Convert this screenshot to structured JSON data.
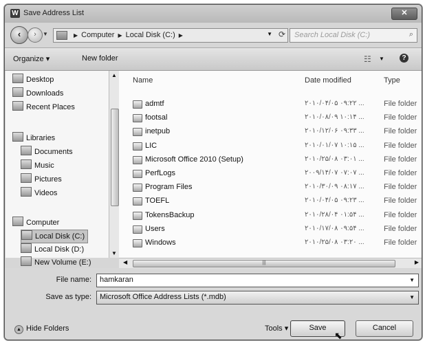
{
  "window": {
    "title": "Save Address List",
    "app_icon_letter": "W",
    "close_label": "✕"
  },
  "address": {
    "crumbs": [
      "Computer",
      "Local Disk (C:)"
    ]
  },
  "search": {
    "placeholder": "Search Local Disk (C:)"
  },
  "toolbar": {
    "organize": "Organize ▾",
    "new_folder": "New folder"
  },
  "nav": {
    "favorites": [
      {
        "label": "Desktop"
      },
      {
        "label": "Downloads"
      },
      {
        "label": "Recent Places"
      }
    ],
    "libraries_label": "Libraries",
    "libraries": [
      {
        "label": "Documents"
      },
      {
        "label": "Music"
      },
      {
        "label": "Pictures"
      },
      {
        "label": "Videos"
      }
    ],
    "computer_label": "Computer",
    "drives": [
      {
        "label": "Local Disk (C:)",
        "selected": true
      },
      {
        "label": "Local Disk (D:)"
      },
      {
        "label": "New Volume (E:)"
      }
    ]
  },
  "columns": {
    "name": "Name",
    "date": "Date modified",
    "type": "Type"
  },
  "files": [
    {
      "name": "admtf",
      "date": "۲۰۱۰/۰۴/۰۵ ۰۹:۲۲ ...",
      "type": "File folder"
    },
    {
      "name": "footsal",
      "date": "۲۰۱۰/۰۸/۰۹ ۱۰:۱۴ ...",
      "type": "File folder"
    },
    {
      "name": "inetpub",
      "date": "۲۰۱۰/۱۲/۰۶ ۰۹:۳۳ ...",
      "type": "File folder"
    },
    {
      "name": "LIC",
      "date": "۲۰۱۰/۰۱/۰۷ ۱۰:۱۵ ...",
      "type": "File folder"
    },
    {
      "name": "Microsoft Office 2010 (Setup)",
      "date": "۲۰۱۰/۲۵/۰۸ ۰۳:۰۱ ...",
      "type": "File folder"
    },
    {
      "name": "PerfLogs",
      "date": "۲۰۰۹/۱۴/۰۷ ۰۷:۰۷ ...",
      "type": "File folder"
    },
    {
      "name": "Program Files",
      "date": "۲۰۱۰/۳۰/۰۹ ۰۸:۱۷ ...",
      "type": "File folder"
    },
    {
      "name": "TOEFL",
      "date": "۲۰۱۰/۰۴/۰۵ ۰۹:۲۳ ...",
      "type": "File folder"
    },
    {
      "name": "TokensBackup",
      "date": "۲۰۱۰/۲۸/۰۴ ۰۱:۵۴ ...",
      "type": "File folder"
    },
    {
      "name": "Users",
      "date": "۲۰۱۰/۱۷/۰۸ ۰۹:۵۴ ...",
      "type": "File folder"
    },
    {
      "name": "Windows",
      "date": "۲۰۱۰/۲۵/۰۸ ۰۳:۲۰ ...",
      "type": "File folder"
    }
  ],
  "form": {
    "file_name_label": "File name:",
    "file_name_value": "hamkaran",
    "save_type_label": "Save as type:",
    "save_type_value": "Microsoft Office Address Lists (*.mdb)"
  },
  "footer": {
    "hide_folders": "Hide Folders",
    "tools": "Tools ▾",
    "save": "Save",
    "cancel": "Cancel"
  }
}
